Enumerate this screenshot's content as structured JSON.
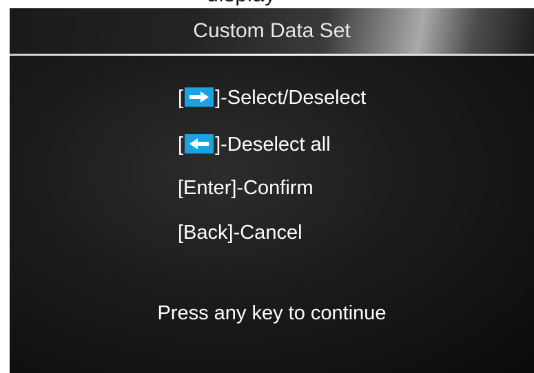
{
  "page_top_fragment": "display",
  "title_bar": {
    "title": "Custom Data Set"
  },
  "instructions": [
    {
      "prefix": "[",
      "suffix": "]-Select/Deselect",
      "icon": "arrow-right-icon"
    },
    {
      "prefix": "[",
      "suffix": "]-Deselect all",
      "icon": "arrow-left-icon"
    },
    {
      "text": "[Enter]-Confirm"
    },
    {
      "text": "[Back]-Cancel"
    }
  ],
  "footer": {
    "message": "Press any key to continue"
  },
  "colors": {
    "key_icon_blue": "#1aa3e0",
    "text": "#ffffff",
    "title_text": "#e8e8e8",
    "screen_bg": "#1b1b1b"
  }
}
